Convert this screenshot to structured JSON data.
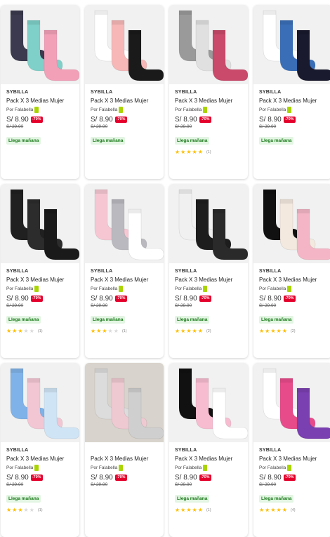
{
  "colors": {
    "accent": "#e4002b",
    "seller_badge": "#aad500",
    "delivery_text": "#1a7a1a",
    "star": "#ffbe00"
  },
  "products": [
    {
      "brand": "SYBILLA",
      "title": "Pack X 3 Medias Mujer",
      "seller": "Por Falabella",
      "price": "S/ 8.90",
      "discount": "-70%",
      "old_price": "S/ 29.90",
      "delivery": "Llega mañana",
      "rating": null,
      "rating_count": null,
      "image": "socks-star-mint-pink-stars"
    },
    {
      "brand": "SYBILLA",
      "title": "Pack X 3 Medias Mujer",
      "seller": "Por Falabella",
      "price": "S/ 8.90",
      "discount": "-70%",
      "old_price": "S/ 29.90",
      "delivery": "Llega mañana",
      "rating": null,
      "rating_count": null,
      "image": "socks-white-pink-ribbed"
    },
    {
      "brand": "SYBILLA",
      "title": "Pack X 3 Medias Mujer",
      "seller": "Por Falabella",
      "price": "S/ 8.90",
      "discount": "-70%",
      "old_price": "S/ 29.90",
      "delivery": "Llega mañana",
      "rating": 5,
      "rating_count": "(1)",
      "image": "socks-grey-dots-stripes"
    },
    {
      "brand": "SYBILLA",
      "title": "Pack X 3 Medias Mujer",
      "seller": "Por Falabella",
      "price": "S/ 8.90",
      "discount": "-70%",
      "old_price": "S/ 29.90",
      "delivery": "Llega mañana",
      "rating": null,
      "rating_count": null,
      "image": "socks-blue-eyes-pattern"
    },
    {
      "brand": "SYBILLA",
      "title": "Pack X 3 Medias Mujer",
      "seller": "Por Falabella",
      "price": "S/ 8.90",
      "discount": "-70%",
      "old_price": "S/ 29.90",
      "delivery": "Llega mañana",
      "rating": 3,
      "rating_count": "(1)",
      "image": "socks-black-glitter"
    },
    {
      "brand": "SYBILLA",
      "title": "Pack X 3 Medias Mujer",
      "seller": "Por Falabella",
      "price": "S/ 8.90",
      "discount": "-70%",
      "old_price": "S/ 29.90",
      "delivery": "Llega mañana",
      "rating": 3,
      "rating_count": "(1)",
      "image": "socks-pink-grey-cats"
    },
    {
      "brand": "SYBILLA",
      "title": "Pack X 3 Medias Mujer",
      "seller": "Por Falabella",
      "price": "S/ 8.90",
      "discount": "-70%",
      "old_price": "S/ 29.90",
      "delivery": "Llega mañana",
      "rating": 4.5,
      "rating_count": "(2)",
      "image": "socks-black-white-stripes-dots"
    },
    {
      "brand": "SYBILLA",
      "title": "Pack X 3 Medias Mujer",
      "seller": "Por Falabella",
      "price": "S/ 8.90",
      "discount": "-70%",
      "old_price": "S/ 29.90",
      "delivery": "Llega mañana",
      "rating": 5,
      "rating_count": "(2)",
      "image": "socks-black-grid-hearts"
    },
    {
      "brand": "SYBILLA",
      "title": "Pack X 3 Medias Mujer",
      "seller": "Por Falabella",
      "price": "S/ 8.90",
      "discount": "-70%",
      "old_price": "S/ 29.90",
      "delivery": "Llega mañana",
      "rating": 3,
      "rating_count": "(1)",
      "image": "socks-blue-polka-stripes"
    },
    {
      "brand": "",
      "title": "Pack X 3 Medias Mujer",
      "seller": "Por Falabella",
      "price": "S/ 8.90",
      "discount": "-70%",
      "old_price": "S/ 29.90",
      "delivery": "",
      "rating": null,
      "rating_count": null,
      "image": "socks-no-show-cat-faces"
    },
    {
      "brand": "SYBILLA",
      "title": "Pack X 3 Medias Mujer",
      "seller": "Por Falabella",
      "price": "S/ 8.90",
      "discount": "-70%",
      "old_price": "S/ 29.90",
      "delivery": "Llega mañana",
      "rating": 5,
      "rating_count": "(1)",
      "image": "socks-black-pink-stripes"
    },
    {
      "brand": "SYBILLA",
      "title": "Pack X 3 Medias Mujer",
      "seller": "Por Falabella",
      "price": "S/ 8.90",
      "discount": "-70%",
      "old_price": "S/ 29.90",
      "delivery": "Llega mañana",
      "rating": 5,
      "rating_count": "(4)",
      "image": "socks-pink-leopard"
    }
  ]
}
